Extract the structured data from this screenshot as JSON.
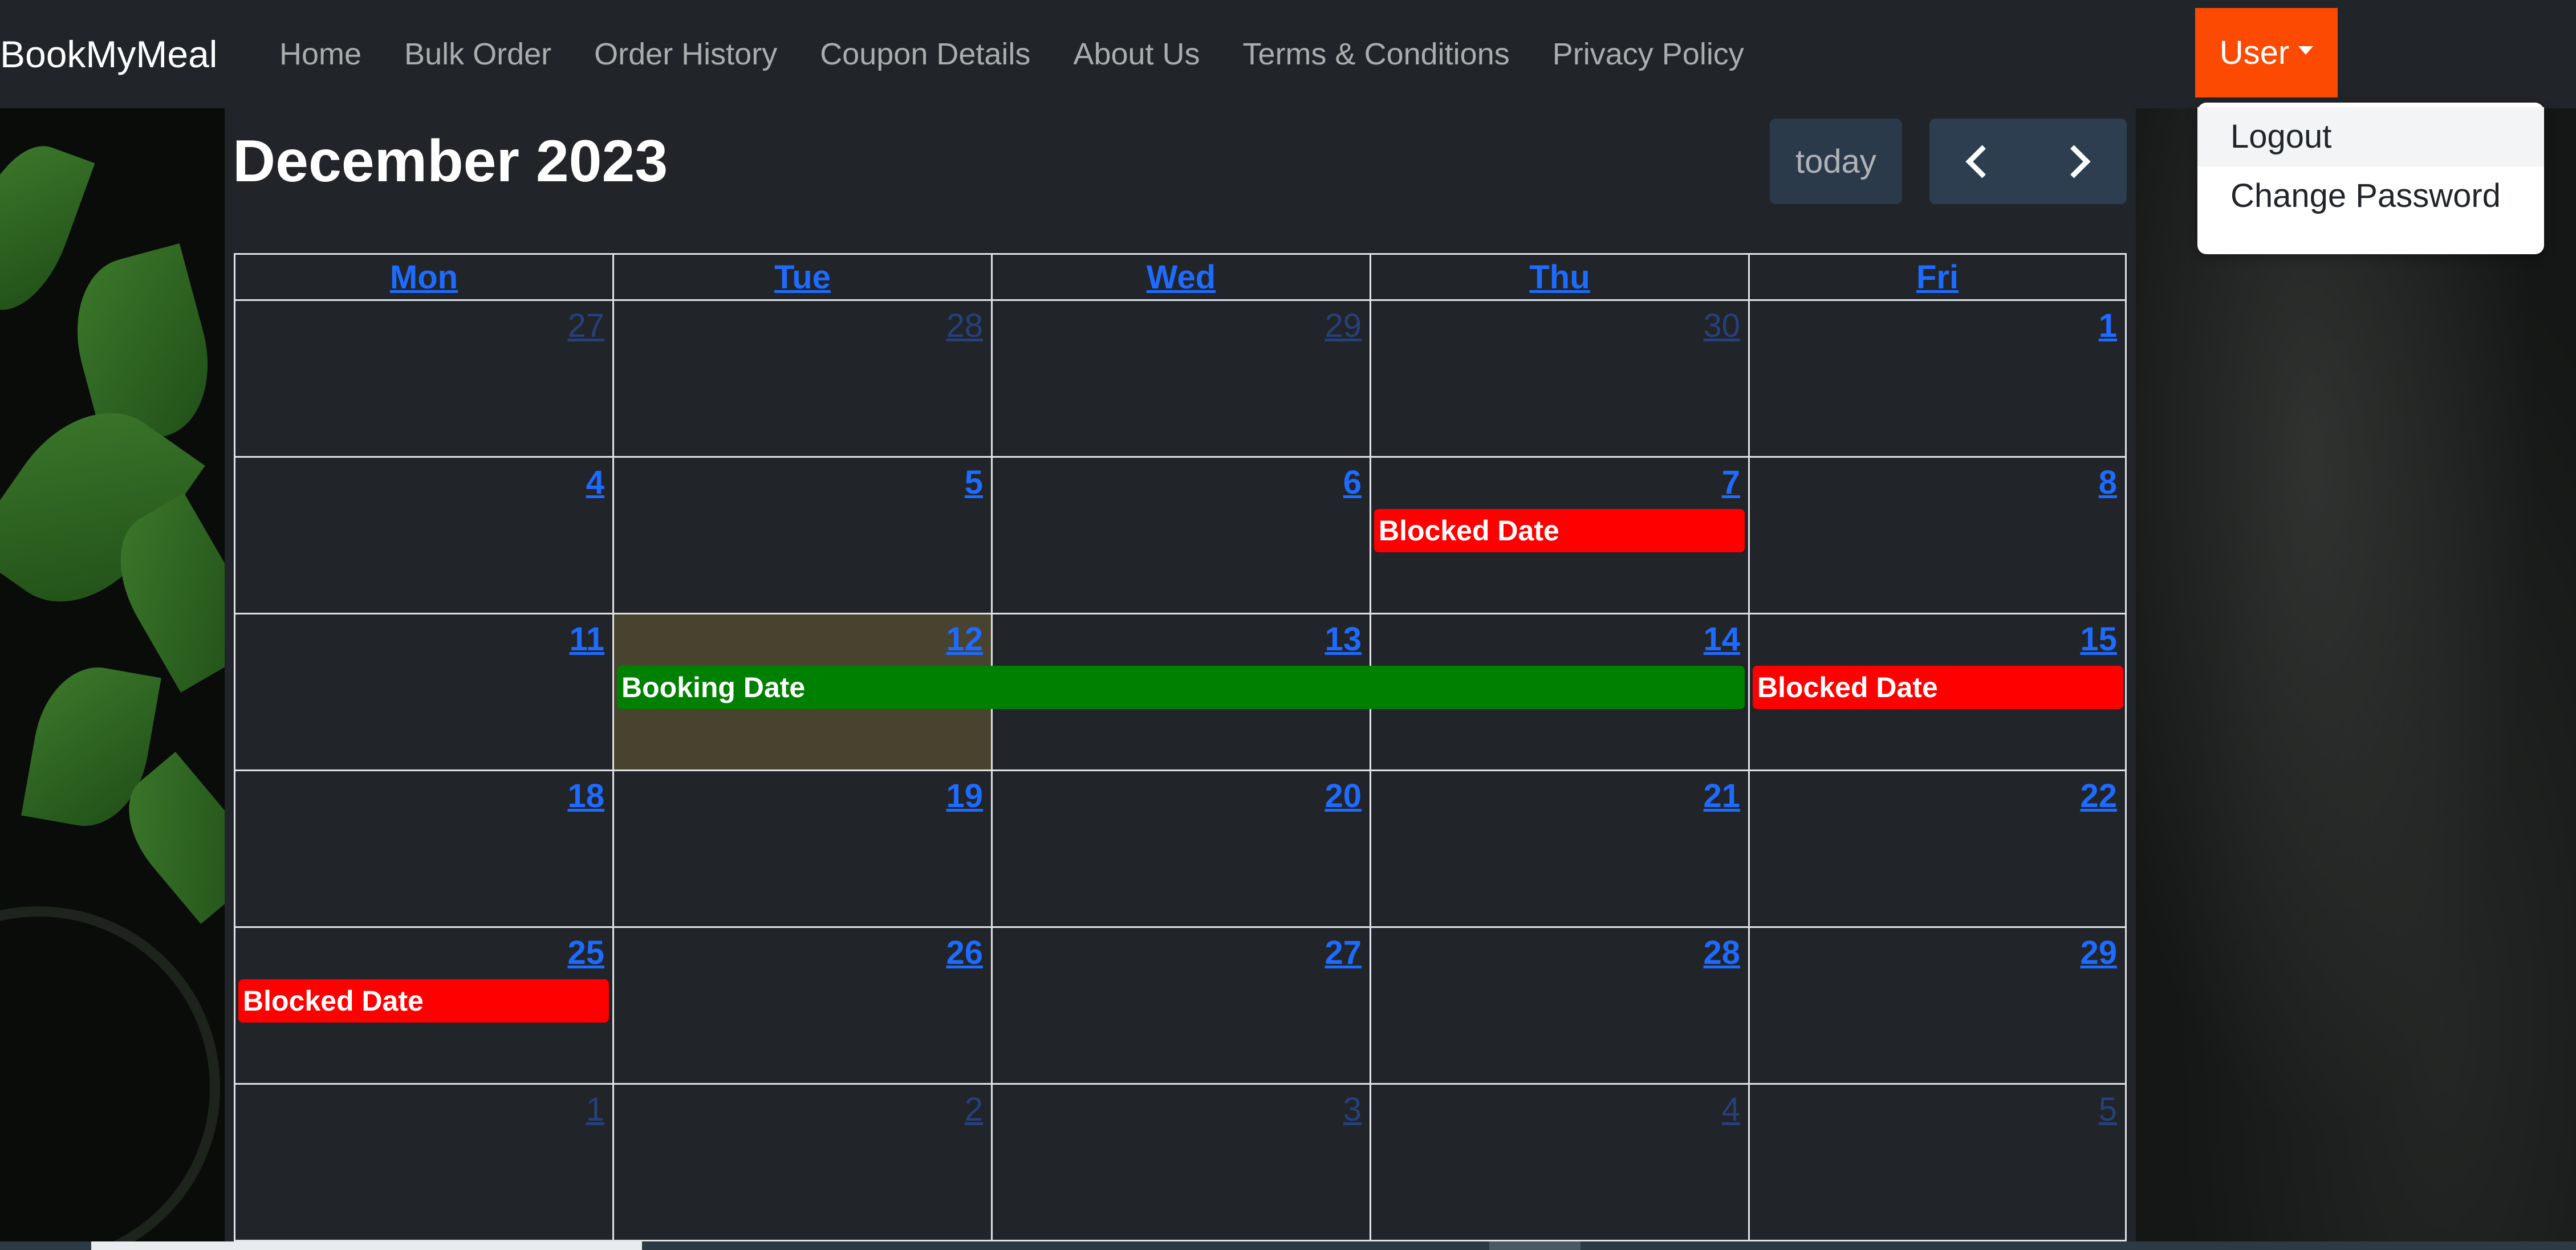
{
  "navbar": {
    "brand": "BookMyMeal",
    "links": [
      "Home",
      "Bulk Order",
      "Order History",
      "Coupon Details",
      "About Us",
      "Terms & Conditions",
      "Privacy Policy"
    ],
    "user_label": "User",
    "user_color": "#fc4a02"
  },
  "user_menu": {
    "items": [
      "Logout",
      "Change Password"
    ]
  },
  "calendar": {
    "title": "December 2023",
    "today_label": "today",
    "weekdays": [
      "Mon",
      "Tue",
      "Wed",
      "Thu",
      "Fri"
    ],
    "weeks": [
      [
        {
          "n": "27",
          "other": true
        },
        {
          "n": "28",
          "other": true
        },
        {
          "n": "29",
          "other": true
        },
        {
          "n": "30",
          "other": true
        },
        {
          "n": "1"
        }
      ],
      [
        {
          "n": "4"
        },
        {
          "n": "5"
        },
        {
          "n": "6"
        },
        {
          "n": "7"
        },
        {
          "n": "8"
        }
      ],
      [
        {
          "n": "11"
        },
        {
          "n": "12",
          "today": true
        },
        {
          "n": "13"
        },
        {
          "n": "14"
        },
        {
          "n": "15"
        }
      ],
      [
        {
          "n": "18"
        },
        {
          "n": "19"
        },
        {
          "n": "20"
        },
        {
          "n": "21"
        },
        {
          "n": "22"
        }
      ],
      [
        {
          "n": "25"
        },
        {
          "n": "26"
        },
        {
          "n": "27"
        },
        {
          "n": "28"
        },
        {
          "n": "29"
        }
      ],
      [
        {
          "n": "1",
          "other": true
        },
        {
          "n": "2",
          "other": true
        },
        {
          "n": "3",
          "other": true
        },
        {
          "n": "4",
          "other": true
        },
        {
          "n": "5",
          "other": true
        }
      ]
    ],
    "events": [
      {
        "title": "Blocked Date",
        "week": 1,
        "start": 3,
        "span": 1,
        "color": "#ff0000"
      },
      {
        "title": "Booking Date",
        "week": 2,
        "start": 1,
        "span": 3,
        "color": "#008000"
      },
      {
        "title": "Blocked Date",
        "week": 2,
        "start": 4,
        "span": 1,
        "color": "#ff0000"
      },
      {
        "title": "Blocked Date",
        "week": 4,
        "start": 0,
        "span": 1,
        "color": "#ff0000"
      }
    ]
  }
}
